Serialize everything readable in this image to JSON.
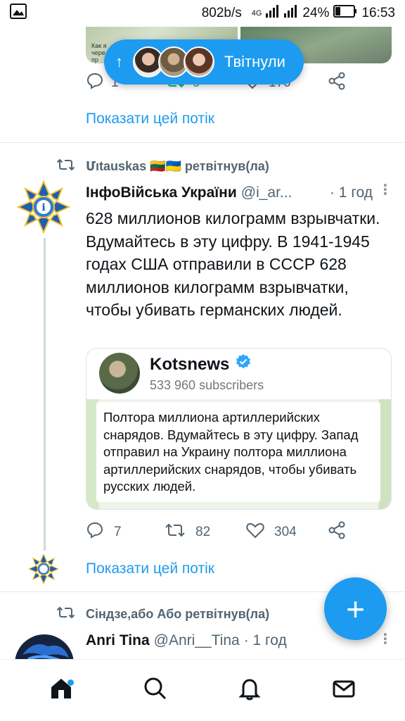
{
  "status_bar": {
    "speed": "802b/s",
    "network": "4G",
    "battery": "24%",
    "time": "16:53",
    "icons": [
      "image-icon",
      "signal-icon",
      "battery-icon"
    ]
  },
  "prev_tweet": {
    "media_caption": "Как я\nчере\nпр",
    "reply_count": "1",
    "retweet_count": "9",
    "like_count": "170",
    "show_thread": "Показати цей потік"
  },
  "tweeted_pill": {
    "label": "Твітнули",
    "arrow": "↑"
  },
  "retweet_banner": {
    "text": "Մıtauskas 🇱🇹🇺🇦 ретвітнув(ла)"
  },
  "tweet": {
    "name": "ІнфоВійська України",
    "handle": "@i_ar...",
    "time": "· 1 год",
    "text": "628 миллионов килограмм взрывчатки. Вдумайтесь в эту цифру. В 1941-1945 годах США отправили в СССР  628 миллионов килограмм взрывчатки, чтобы убивать германских людей.",
    "quote": {
      "channel": "Kotsnews",
      "subscribers": "533 960 subscribers",
      "text": "Полтора миллиона артиллерийских снарядов. Вдумайтесь в эту цифру. Запад отправил на Украину полтора миллиона артиллерийских снарядов, чтобы убивать русских людей."
    },
    "reply_count": "7",
    "retweet_count": "82",
    "like_count": "304",
    "show_thread": "Показати цей потік"
  },
  "next_retweet_banner": {
    "text": "Сіндзе,або Або ретвітнув(ла)"
  },
  "next_tweet": {
    "name": "Anri Tina",
    "handle": "@Anri__Tina",
    "time": "· 1 год"
  },
  "fab": {
    "label": "+"
  },
  "colors": {
    "accent": "#1d9bf0",
    "muted": "#536471",
    "text": "#0f1419"
  },
  "bottom_nav": [
    "home-icon",
    "search-icon",
    "notifications-icon",
    "messages-icon"
  ]
}
